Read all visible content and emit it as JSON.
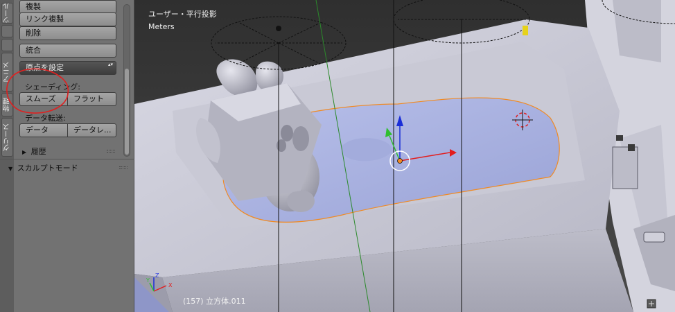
{
  "tabs": [
    "ツール",
    "アニメ",
    "物理",
    "グリース"
  ],
  "tool_panel": {
    "duplicate": "複製",
    "duplicate_linked": "リンク複製",
    "delete": "削除",
    "join": "統合",
    "set_origin": "原点を設定",
    "shading_label": "シェーディング:",
    "smooth": "スムーズ",
    "flat": "フラット",
    "data_transfer_label": "データ転送:",
    "data": "データ",
    "data_layout": "データレ...",
    "history": "履歴"
  },
  "sculpt_mode": {
    "label": "スカルプトモード"
  },
  "viewport": {
    "view_name": "ユーザー・平行投影",
    "units": "Meters",
    "object_info": "(157) 立方体.011",
    "axis_x": "X",
    "axis_y": "Y",
    "axis_z": "Z"
  },
  "colors": {
    "annotation": "#e02020",
    "gizmo_x": "#e31d1d",
    "gizmo_y": "#2fbf2f",
    "gizmo_z": "#1a2ed8",
    "selection_outline": "#f08a24",
    "water": "#a9b2e0"
  }
}
